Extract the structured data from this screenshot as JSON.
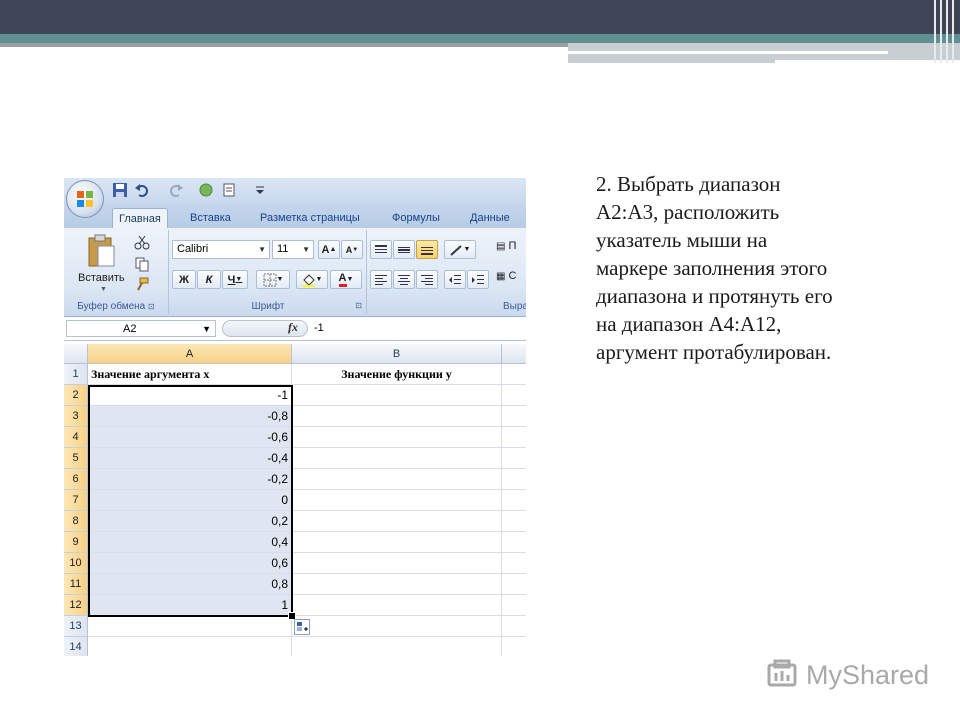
{
  "slide": {
    "instruction": "2. Выбрать диапазон\nА2:А3, расположить\nуказатель мыши на\nмаркере заполнения этого\nдиапазона и протянуть его\nна диапазон А4:А12,\nаргумент протабулирован.",
    "watermark": "MyShared"
  },
  "excel": {
    "tabs": [
      "Главная",
      "Вставка",
      "Разметка страницы",
      "Формулы",
      "Данные"
    ],
    "ribbon": {
      "paste_label": "Вставить",
      "clipboard_group": "Буфер обмена",
      "font_group": "Шрифт",
      "align_group": "Выра",
      "font_name": "Calibri",
      "font_size": "11",
      "bold": "Ж",
      "italic": "К",
      "underline": "Ч",
      "wrap_partial": "П",
      "merge_partial": "С",
      "grow_font": "A",
      "shrink_font": "A",
      "font_color": "A"
    },
    "formula_bar": {
      "name_box": "A2",
      "fx": "fx",
      "value": "-1"
    },
    "columns": [
      "A",
      "B"
    ],
    "rows": [
      {
        "num": "1",
        "a": "Значение аргумента х",
        "b": "Значение функции у"
      },
      {
        "num": "2",
        "a": "-1",
        "b": ""
      },
      {
        "num": "3",
        "a": "-0,8",
        "b": ""
      },
      {
        "num": "4",
        "a": "-0,6",
        "b": ""
      },
      {
        "num": "5",
        "a": "-0,4",
        "b": ""
      },
      {
        "num": "6",
        "a": "-0,2",
        "b": ""
      },
      {
        "num": "7",
        "a": "0",
        "b": ""
      },
      {
        "num": "8",
        "a": "0,2",
        "b": ""
      },
      {
        "num": "9",
        "a": "0,4",
        "b": ""
      },
      {
        "num": "10",
        "a": "0,6",
        "b": ""
      },
      {
        "num": "11",
        "a": "0,8",
        "b": ""
      },
      {
        "num": "12",
        "a": "1",
        "b": ""
      },
      {
        "num": "13",
        "a": "",
        "b": ""
      },
      {
        "num": "14",
        "a": "",
        "b": ""
      }
    ]
  }
}
